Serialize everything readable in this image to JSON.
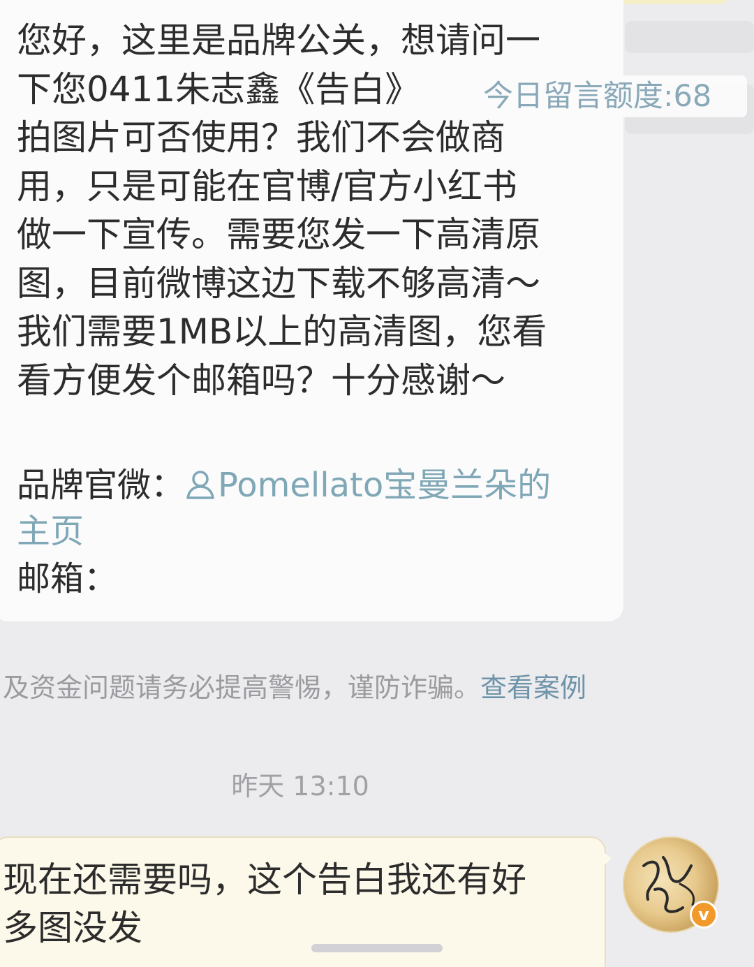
{
  "chat": {
    "incoming_message": {
      "text": "您好，这里是品牌公关，想请问一\n下您0411朱志鑫《告白》\n拍图片可否使用？我们不会做商\n用，只是可能在官博/官方小红书\n做一下宣传。需要您发一下高清原\n图，目前微博这边下载不够高清～\n我们需要1MB以上的高清图，您看\n看方便发个邮箱吗？十分感谢～",
      "brand_label": "品牌官微：",
      "brand_link": "Pomellato宝曼兰朵的",
      "brand_link_cont": "主页",
      "mail_label": "邮箱："
    },
    "quota_badge": "今日留言额度:68",
    "safety_notice": {
      "text": "及资金问题请务必提高警惕，谨防诈骗。",
      "link": "查看案例"
    },
    "timestamp": "昨天 13:10",
    "outgoing_message": {
      "text": "现在还需要吗，这个告白我还有好\n多图没发"
    },
    "avatar": {
      "icon": "user-avatar",
      "badge": "v"
    }
  },
  "colors": {
    "background": "#ececef",
    "incoming_bubble": "#fbfbfc",
    "outgoing_bubble": "#fdf9ea",
    "link": "#7fa7b6",
    "verified_badge": "#f19a2b"
  }
}
